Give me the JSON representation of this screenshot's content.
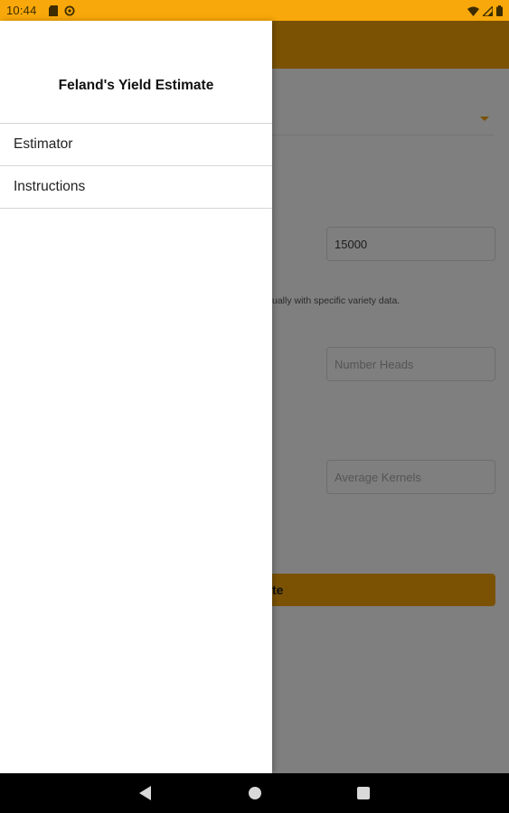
{
  "status_bar": {
    "time": "10:44",
    "left_icons": [
      "sd-card-icon",
      "sync-icon"
    ],
    "right_icons": [
      "wifi-icon",
      "signal-icon",
      "battery-icon"
    ]
  },
  "drawer": {
    "title": "Feland's Yield Estimate",
    "items": [
      {
        "label": "Estimator"
      },
      {
        "label": "Instructions"
      }
    ]
  },
  "background": {
    "field_value": "15000",
    "note_fragment": "ually with specific variety data.",
    "heads_placeholder": "Number Heads",
    "kernels_placeholder": "Average Kernels",
    "button_fragment": "te"
  },
  "colors": {
    "status_bar": "#f8a80a",
    "app_bar_dimmed": "#7b5203",
    "scrim": "#7f7f7f",
    "drawer": "#ffffff"
  },
  "nav_bar": {
    "icons": [
      "back-icon",
      "home-icon",
      "recents-icon"
    ]
  }
}
